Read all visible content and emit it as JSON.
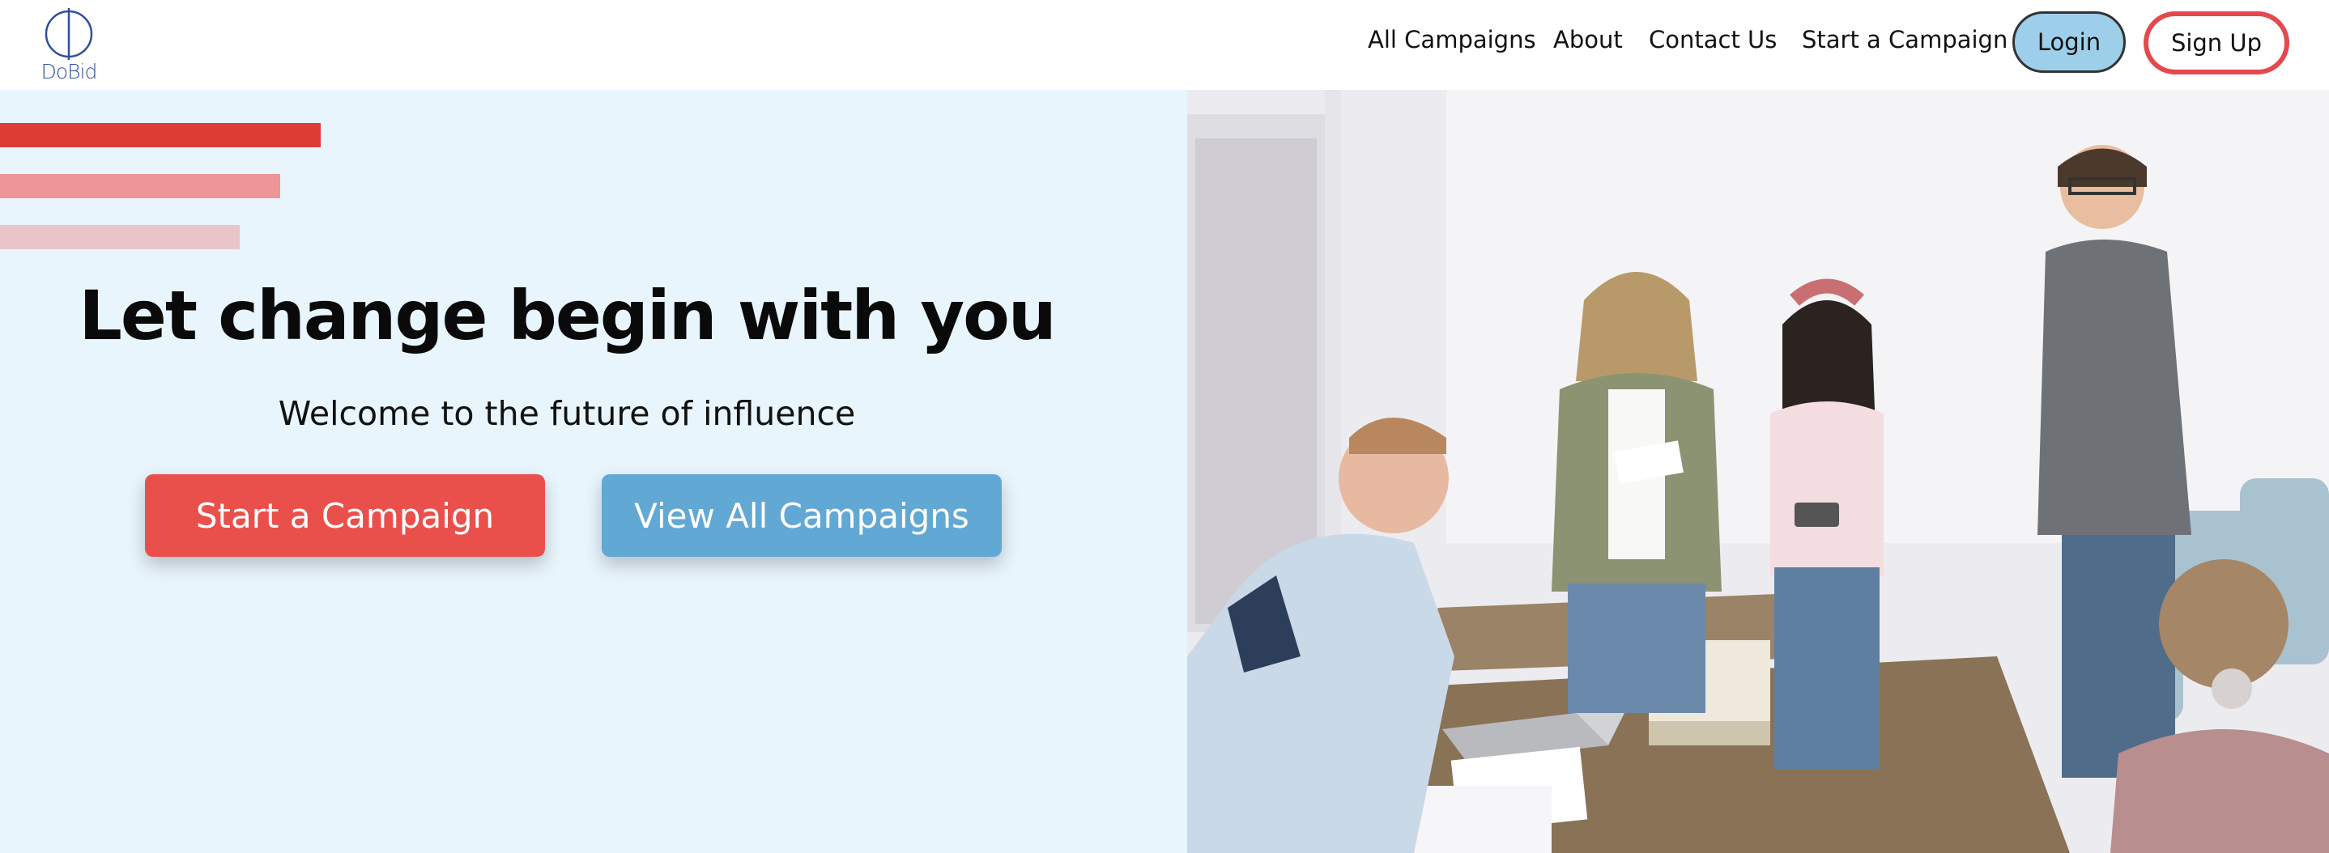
{
  "brand": {
    "name": "DoBid",
    "color": "#2f4fa0"
  },
  "nav": {
    "links": [
      "All Campaigns",
      "About",
      "Contact Us",
      "Start a Campaign"
    ],
    "login_label": "Login",
    "signup_label": "Sign Up"
  },
  "hero": {
    "title": "Let change begin with you",
    "subtitle": "Welcome to the future of influence",
    "cta_primary": "Start a Campaign",
    "cta_secondary": "View All Campaigns",
    "photo_icon": "students-classroom-photo"
  },
  "colors": {
    "accent_red": "#ea504b",
    "accent_blue": "#62a8d4",
    "hero_background": "#e8f5fc",
    "login_background": "#9ecfea",
    "signup_border": "#e5484d"
  }
}
